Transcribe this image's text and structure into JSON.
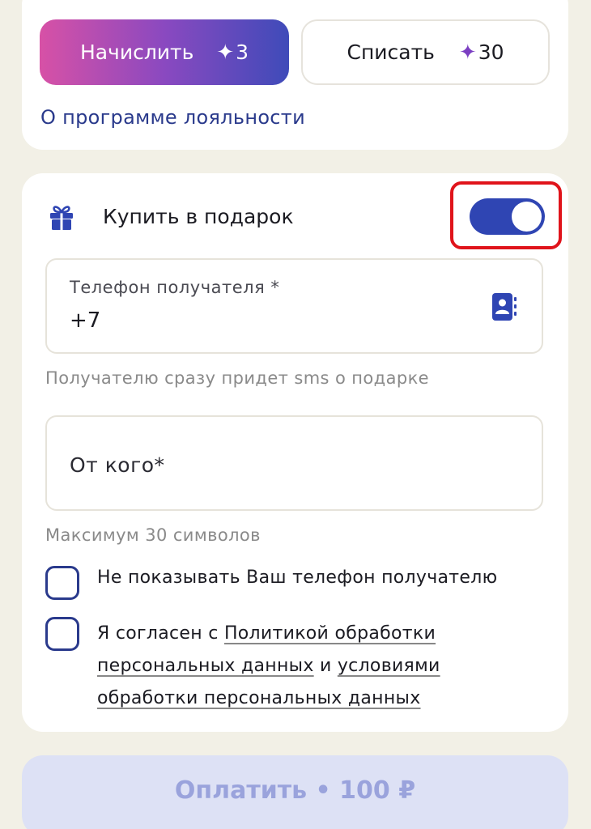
{
  "loyalty": {
    "accrue_label": "Начислить",
    "accrue_points": "3",
    "writeoff_label": "Списать",
    "writeoff_points": "30",
    "program_link": "О программе лояльности"
  },
  "gift": {
    "title": "Купить в подарок",
    "toggle_on": true,
    "phone_label": "Телефон получателя *",
    "phone_value": "+7",
    "phone_hint": "Получателю сразу придет sms о подарке",
    "from_placeholder": "От кого*",
    "from_hint": "Максимум 30 символов",
    "hide_phone_label": "Не показывать Ваш телефон получателю",
    "consent_prefix": "Я согласен с",
    "consent_policy_link": "Политикой обработки персональных данных",
    "consent_and": "и",
    "consent_terms_link": "условиями обработки персональных данных"
  },
  "pay": {
    "label": "Оплатить • 100 ₽"
  },
  "colors": {
    "accent": "#2f45b3",
    "highlight": "#e0141b",
    "gradient_start": "#d751a6",
    "gradient_end": "#3f4bb9"
  },
  "icons": [
    "star-icon",
    "gift-icon",
    "contacts-icon"
  ]
}
